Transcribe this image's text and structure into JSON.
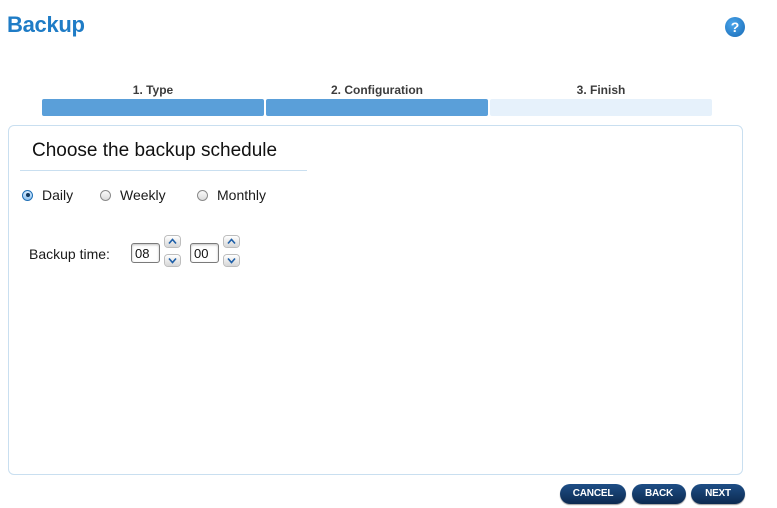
{
  "header": {
    "title": "Backup",
    "help_icon_label": "?"
  },
  "steps": [
    {
      "label": "1. Type",
      "status": "complete",
      "bar_color": "#5a9fd9"
    },
    {
      "label": "2. Configuration",
      "status": "current",
      "bar_color": "#5a9fd9"
    },
    {
      "label": "3. Finish",
      "status": "pending",
      "bar_color": "#e6f1fb"
    }
  ],
  "panel": {
    "heading": "Choose the backup schedule",
    "schedule_options": [
      {
        "label": "Daily",
        "checked": true
      },
      {
        "label": "Weekly",
        "checked": false
      },
      {
        "label": "Monthly",
        "checked": false
      }
    ],
    "backup_time": {
      "label": "Backup time:",
      "hour": "08",
      "minute": "00"
    }
  },
  "footer": {
    "cancel_label": "CANCEL",
    "back_label": "BACK",
    "next_label": "NEXT"
  },
  "colors": {
    "title": "#1f7cc6",
    "button": "#0c2a50"
  }
}
